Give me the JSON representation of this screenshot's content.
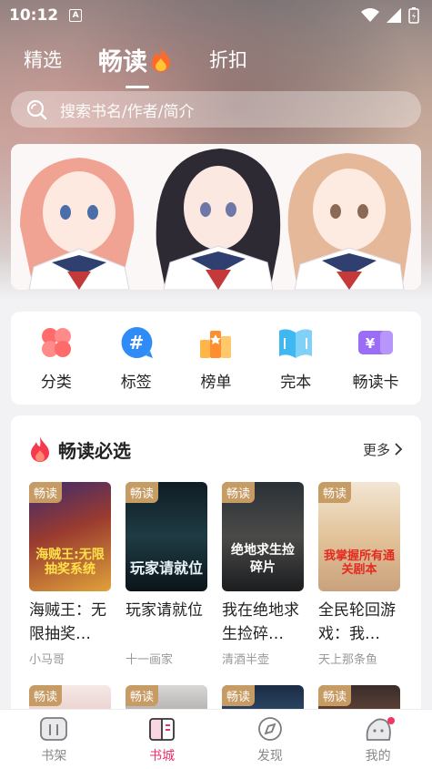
{
  "status": {
    "time": "10:12",
    "notif_letter": "A"
  },
  "tabs": [
    {
      "label": "精选"
    },
    {
      "label": "畅读"
    },
    {
      "label": "折扣"
    }
  ],
  "search": {
    "placeholder": "搜索书名/作者/简介"
  },
  "quick": [
    {
      "label": "分类",
      "icon": "category-icon"
    },
    {
      "label": "标签",
      "icon": "tag-icon"
    },
    {
      "label": "榜单",
      "icon": "ranking-icon"
    },
    {
      "label": "完本",
      "icon": "finished-book-icon"
    },
    {
      "label": "畅读卡",
      "icon": "reading-card-icon"
    }
  ],
  "picks": {
    "title": "畅读必选",
    "more": "更多",
    "books": [
      {
        "tag": "畅读",
        "cover_text": "海贼王:无限抽奖系统",
        "title": "海贼王：无限抽奖…",
        "author": "小马哥"
      },
      {
        "tag": "畅读",
        "cover_text": "玩家请就位",
        "title": "玩家请就位",
        "author": "十一画家"
      },
      {
        "tag": "畅读",
        "cover_text": "绝地求生捡碎片",
        "title": "我在绝地求生捡碎…",
        "author": "清酒半壶"
      },
      {
        "tag": "畅读",
        "cover_text": "我掌握所有通关剧本",
        "title": "全民轮回游戏：我…",
        "author": "天上那条鱼"
      }
    ],
    "row2_tags": [
      "畅读",
      "畅读",
      "畅读",
      "畅读"
    ]
  },
  "nav": [
    {
      "label": "书架",
      "icon": "bookshelf-icon"
    },
    {
      "label": "书城",
      "icon": "bookstore-icon"
    },
    {
      "label": "发现",
      "icon": "compass-icon"
    },
    {
      "label": "我的",
      "icon": "profile-icon"
    }
  ],
  "colors": {
    "accent": "#e8336b",
    "tag": "#c79b64"
  }
}
